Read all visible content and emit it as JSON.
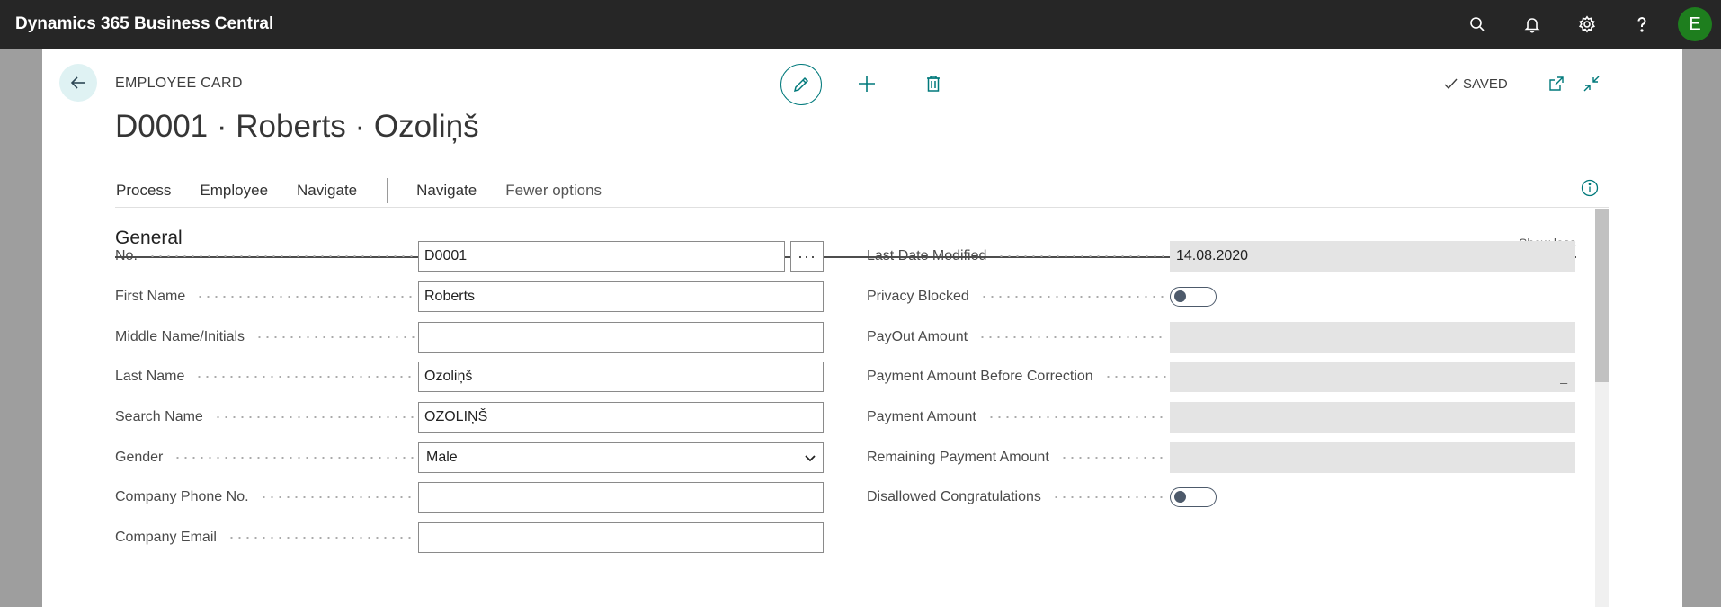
{
  "app": {
    "title": "Dynamics 365 Business Central",
    "user_initial": "E"
  },
  "topbar_icons": [
    "search-icon",
    "bell-icon",
    "gear-icon",
    "help-icon"
  ],
  "page": {
    "caption": "EMPLOYEE CARD",
    "record_title": "D0001 · Roberts · Ozoliņš",
    "saved_label": "SAVED"
  },
  "actions": {
    "items": [
      "Process",
      "Employee",
      "Navigate"
    ],
    "after_sep": [
      "Navigate"
    ],
    "fewer": "Fewer options"
  },
  "section": {
    "title": "General",
    "toggle_label": "Show less"
  },
  "left_fields": [
    {
      "label": "No.",
      "value": "D0001"
    },
    {
      "label": "First Name",
      "value": "Roberts"
    },
    {
      "label": "Middle Name/Initials",
      "value": ""
    },
    {
      "label": "Last Name",
      "value": "Ozoliņš"
    },
    {
      "label": "Search Name",
      "value": "OZOLIŅŠ"
    },
    {
      "label": "Gender",
      "value": "Male"
    },
    {
      "label": "Company Phone No.",
      "value": ""
    },
    {
      "label": "Company Email",
      "value": ""
    }
  ],
  "right_fields": [
    {
      "label": "Last Date Modified",
      "value": "14.08.2020"
    },
    {
      "label": "Privacy Blocked",
      "value": ""
    },
    {
      "label": "PayOut Amount",
      "value": "_"
    },
    {
      "label": "Payment Amount Before Correction",
      "value": "_"
    },
    {
      "label": "Payment Amount",
      "value": "_"
    },
    {
      "label": "Remaining Payment Amount",
      "value": ""
    },
    {
      "label": "Disallowed Congratulations",
      "value": ""
    }
  ],
  "lookup_symbol": "···"
}
